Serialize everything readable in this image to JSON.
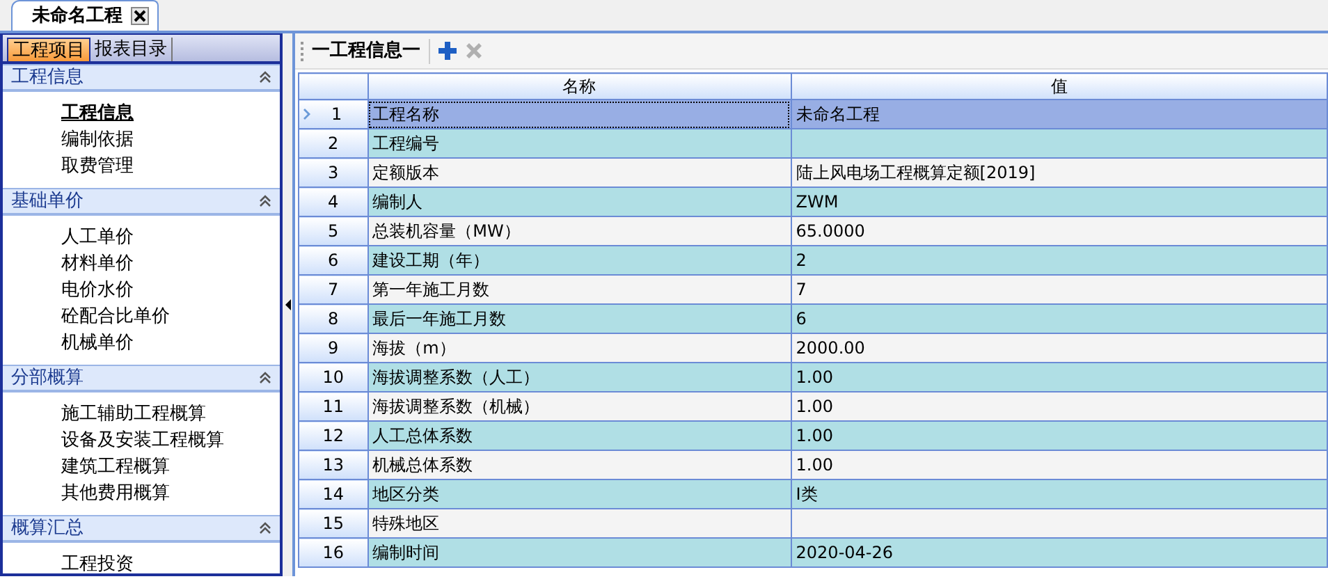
{
  "document_tab": {
    "title": "未命名工程",
    "closable": true
  },
  "sidebar": {
    "tabs": [
      {
        "label": "工程项目",
        "selected": true
      },
      {
        "label": "报表目录",
        "selected": false
      }
    ],
    "sections": [
      {
        "title": "工程信息",
        "expanded": true,
        "items": [
          {
            "label": "工程信息",
            "selected": true
          },
          {
            "label": "编制依据",
            "selected": false
          },
          {
            "label": "取费管理",
            "selected": false
          }
        ]
      },
      {
        "title": "基础单价",
        "expanded": true,
        "items": [
          {
            "label": "人工单价",
            "selected": false
          },
          {
            "label": "材料单价",
            "selected": false
          },
          {
            "label": "电价水价",
            "selected": false
          },
          {
            "label": "砼配合比单价",
            "selected": false
          },
          {
            "label": "机械单价",
            "selected": false
          }
        ]
      },
      {
        "title": "分部概算",
        "expanded": true,
        "items": [
          {
            "label": "施工辅助工程概算",
            "selected": false
          },
          {
            "label": "设备及安装工程概算",
            "selected": false
          },
          {
            "label": "建筑工程概算",
            "selected": false
          },
          {
            "label": "其他费用概算",
            "selected": false
          }
        ]
      },
      {
        "title": "概算汇总",
        "expanded": true,
        "items": [
          {
            "label": "工程投资",
            "selected": false
          }
        ]
      }
    ]
  },
  "toolbar": {
    "title": "一工程信息一",
    "buttons": [
      {
        "kind": "add",
        "disabled": false
      },
      {
        "kind": "delete",
        "disabled": true
      }
    ]
  },
  "table": {
    "columns": [
      "名称",
      "值"
    ],
    "rows": [
      {
        "index": "1",
        "name": "工程名称",
        "value": "未命名工程",
        "selected": true
      },
      {
        "index": "2",
        "name": "工程编号",
        "value": "",
        "selected": false
      },
      {
        "index": "3",
        "name": "定额版本",
        "value": "陆上风电场工程概算定额[2019]",
        "selected": false
      },
      {
        "index": "4",
        "name": "编制人",
        "value": "ZWM",
        "selected": false
      },
      {
        "index": "5",
        "name": "总装机容量（MW）",
        "value": "65.0000",
        "selected": false
      },
      {
        "index": "6",
        "name": "建设工期（年）",
        "value": "2",
        "selected": false
      },
      {
        "index": "7",
        "name": "第一年施工月数",
        "value": "7",
        "selected": false
      },
      {
        "index": "8",
        "name": "最后一年施工月数",
        "value": "6",
        "selected": false
      },
      {
        "index": "9",
        "name": "海拔（m）",
        "value": "2000.00",
        "selected": false
      },
      {
        "index": "10",
        "name": "海拔调整系数（人工）",
        "value": "1.00",
        "selected": false
      },
      {
        "index": "11",
        "name": "海拔调整系数（机械）",
        "value": "1.00",
        "selected": false
      },
      {
        "index": "12",
        "name": "人工总体系数",
        "value": "1.00",
        "selected": false
      },
      {
        "index": "13",
        "name": "机械总体系数",
        "value": "1.00",
        "selected": false
      },
      {
        "index": "14",
        "name": "地区分类",
        "value": "Ⅰ类",
        "selected": false
      },
      {
        "index": "15",
        "name": "特殊地区",
        "value": "",
        "selected": false
      },
      {
        "index": "16",
        "name": "编制时间",
        "value": "2020-04-26",
        "selected": false
      }
    ]
  }
}
